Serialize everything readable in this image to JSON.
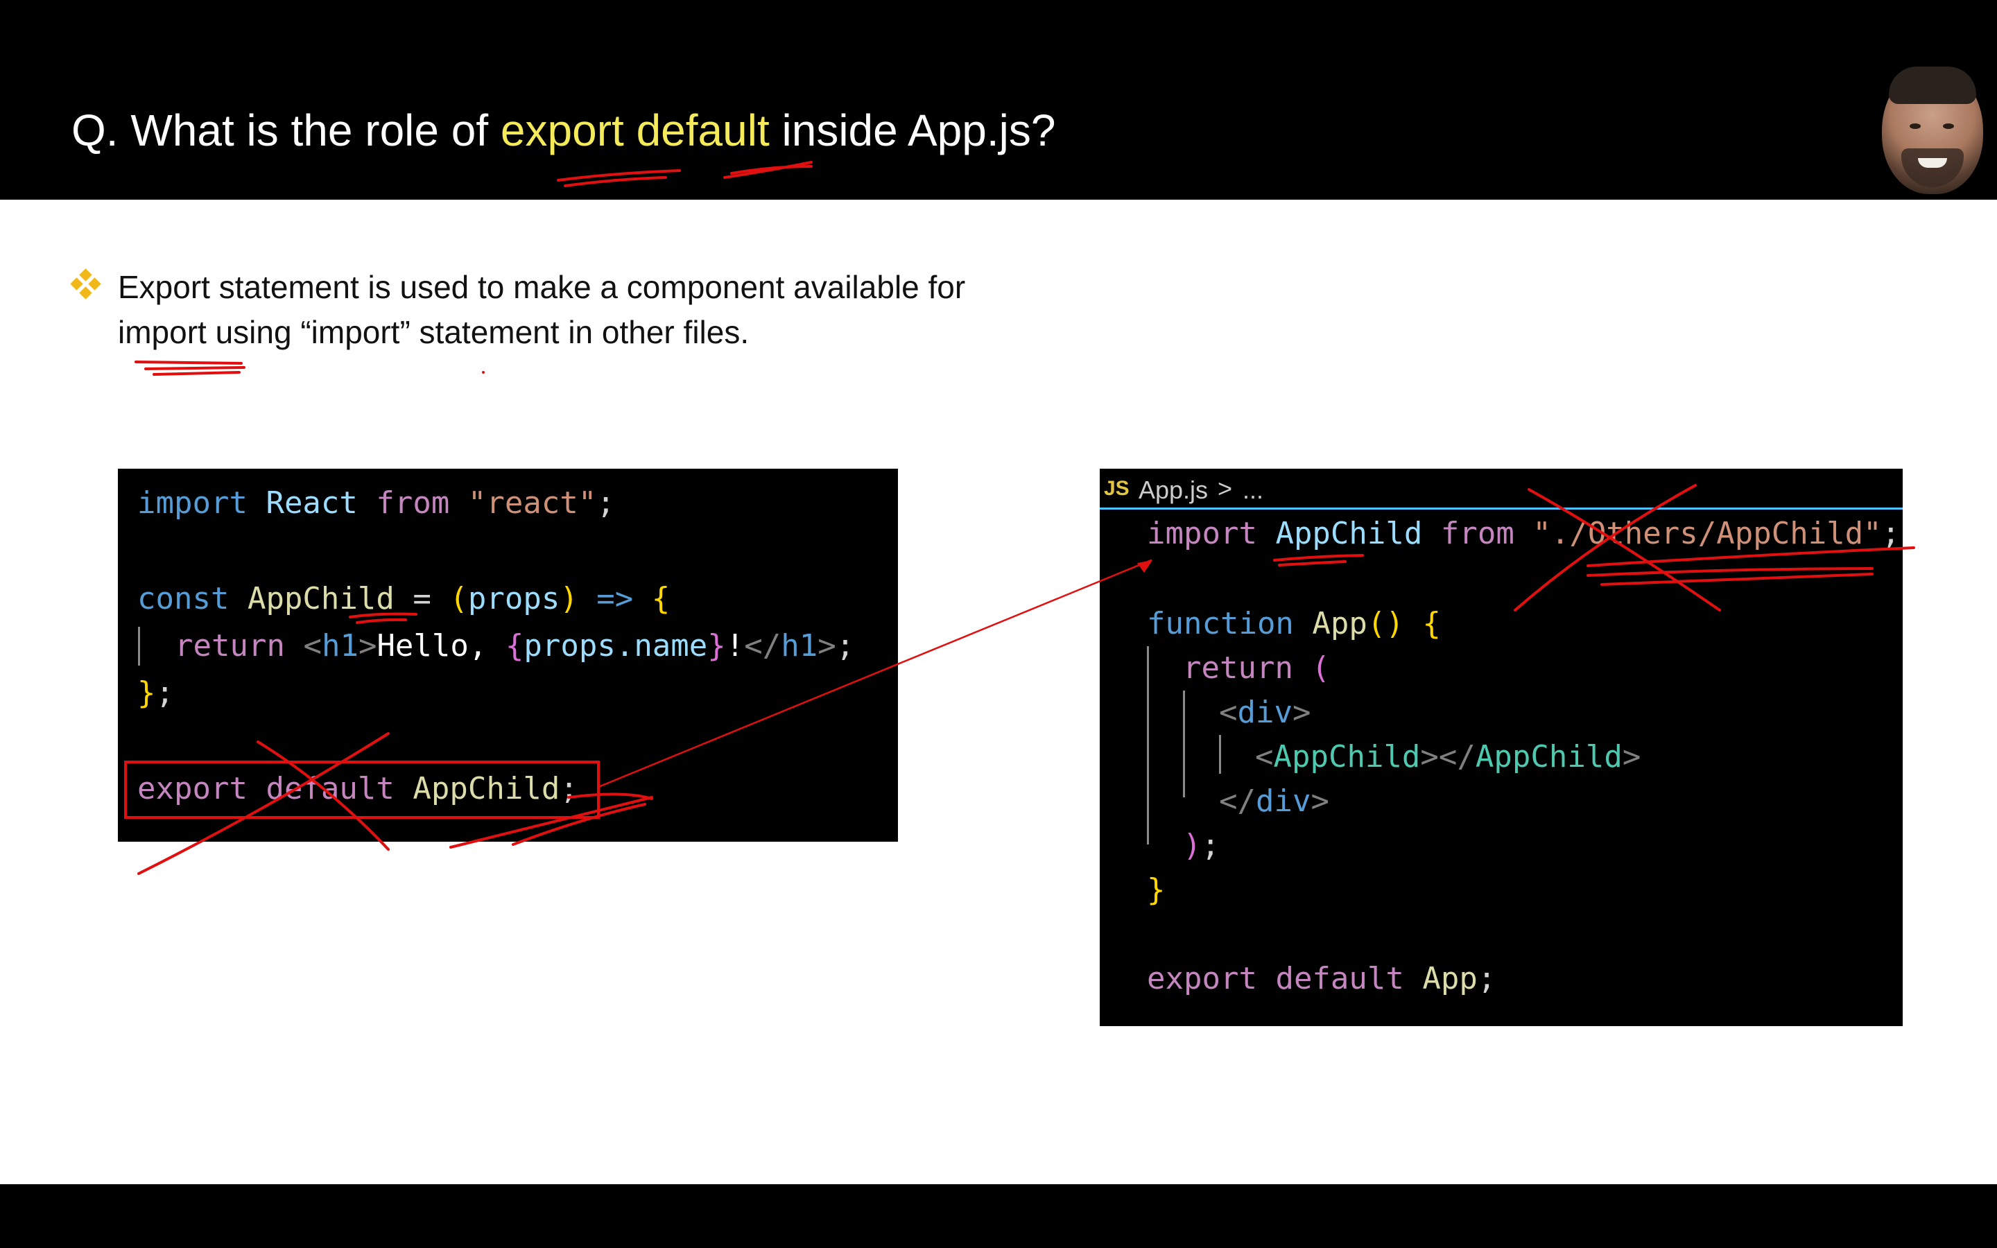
{
  "slide": {
    "question_prefix": "Q. What is the role of ",
    "question_highlight": "export default",
    "question_suffix": " inside App.js?",
    "bullet_text": "Export statement is used to make a component available for import using “import” statement in other files."
  },
  "code_left": {
    "l1": {
      "a": "import",
      "b": "React",
      "c": "from",
      "d": "\"react\"",
      "e": ";"
    },
    "l2": {
      "a": "const",
      "b": "AppChild",
      "c": " = ",
      "d": "(",
      "e": "props",
      "f": ")",
      "g": " => ",
      "h": "{"
    },
    "l3": {
      "a": "return",
      "b": "<",
      "c": "h1",
      "d": ">",
      "e": "Hello, ",
      "f": "{",
      "g": "props.name",
      "h": "}",
      "i": "!",
      "j": "</",
      "k": "h1",
      "l": ">",
      "m": ";"
    },
    "l4": {
      "a": "}",
      "b": ";"
    },
    "l5": {
      "a": "export",
      "b": "default",
      "c": "AppChild",
      "d": ";"
    }
  },
  "code_right": {
    "tab": {
      "icon": "JS",
      "file": "App.js",
      "sep": ">",
      "more": "..."
    },
    "l1": {
      "a": "import",
      "b": "AppChild",
      "c": "from",
      "d": "\"./Others/AppChild\"",
      "e": ";"
    },
    "l2": {
      "a": "function",
      "b": "App",
      "c": "()",
      "d": "{"
    },
    "l3": {
      "a": "return",
      "b": "("
    },
    "l4": {
      "a": "<",
      "b": "div",
      "c": ">"
    },
    "l5": {
      "a": "<",
      "b": "AppChild",
      "c": "></",
      "d": "AppChild",
      "e": ">"
    },
    "l6": {
      "a": "</",
      "b": "div",
      "c": ">"
    },
    "l7": {
      "a": ")",
      "b": ";"
    },
    "l8": {
      "a": "}"
    },
    "l9": {
      "a": "export",
      "b": "default",
      "c": "App",
      "d": ";"
    }
  },
  "colors": {
    "highlight": "#f4ea5a",
    "annotation_red": "#e01010",
    "bullet": "#f2b81a",
    "tab_underline": "#4fc1ff"
  },
  "icons": {
    "bullet": "diamond-bullet-icon",
    "file": "js-file-icon",
    "presenter": "presenter-avatar"
  }
}
